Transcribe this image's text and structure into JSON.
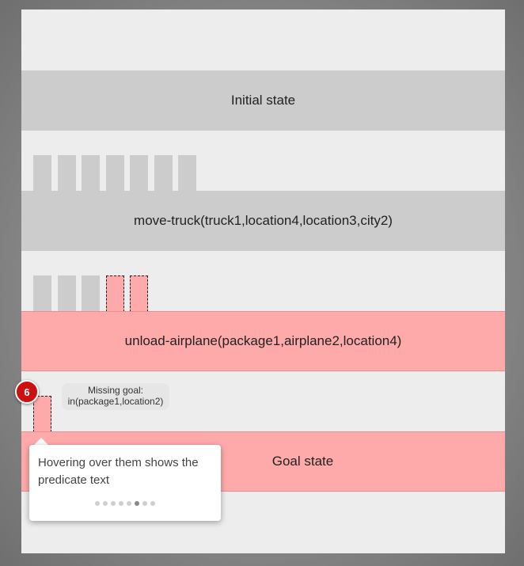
{
  "bands": {
    "initial": "Initial state",
    "action1": "move-truck(truck1,location4,location3,city2)",
    "action2": "unload-airplane(package1,airplane2,location4)",
    "goal": "Goal state"
  },
  "missing_goal": {
    "line1": "Missing goal:",
    "line2": "in(package1,location2)"
  },
  "badge": {
    "number": "6",
    "color": "#cc1111"
  },
  "tooltip": {
    "text": "Hovering over them shows the predicate text",
    "pages_total": 8,
    "page_active": 6
  },
  "colors": {
    "band_grey": "#cccccc",
    "band_red": "#ffaaaa",
    "panel": "#ededed"
  }
}
